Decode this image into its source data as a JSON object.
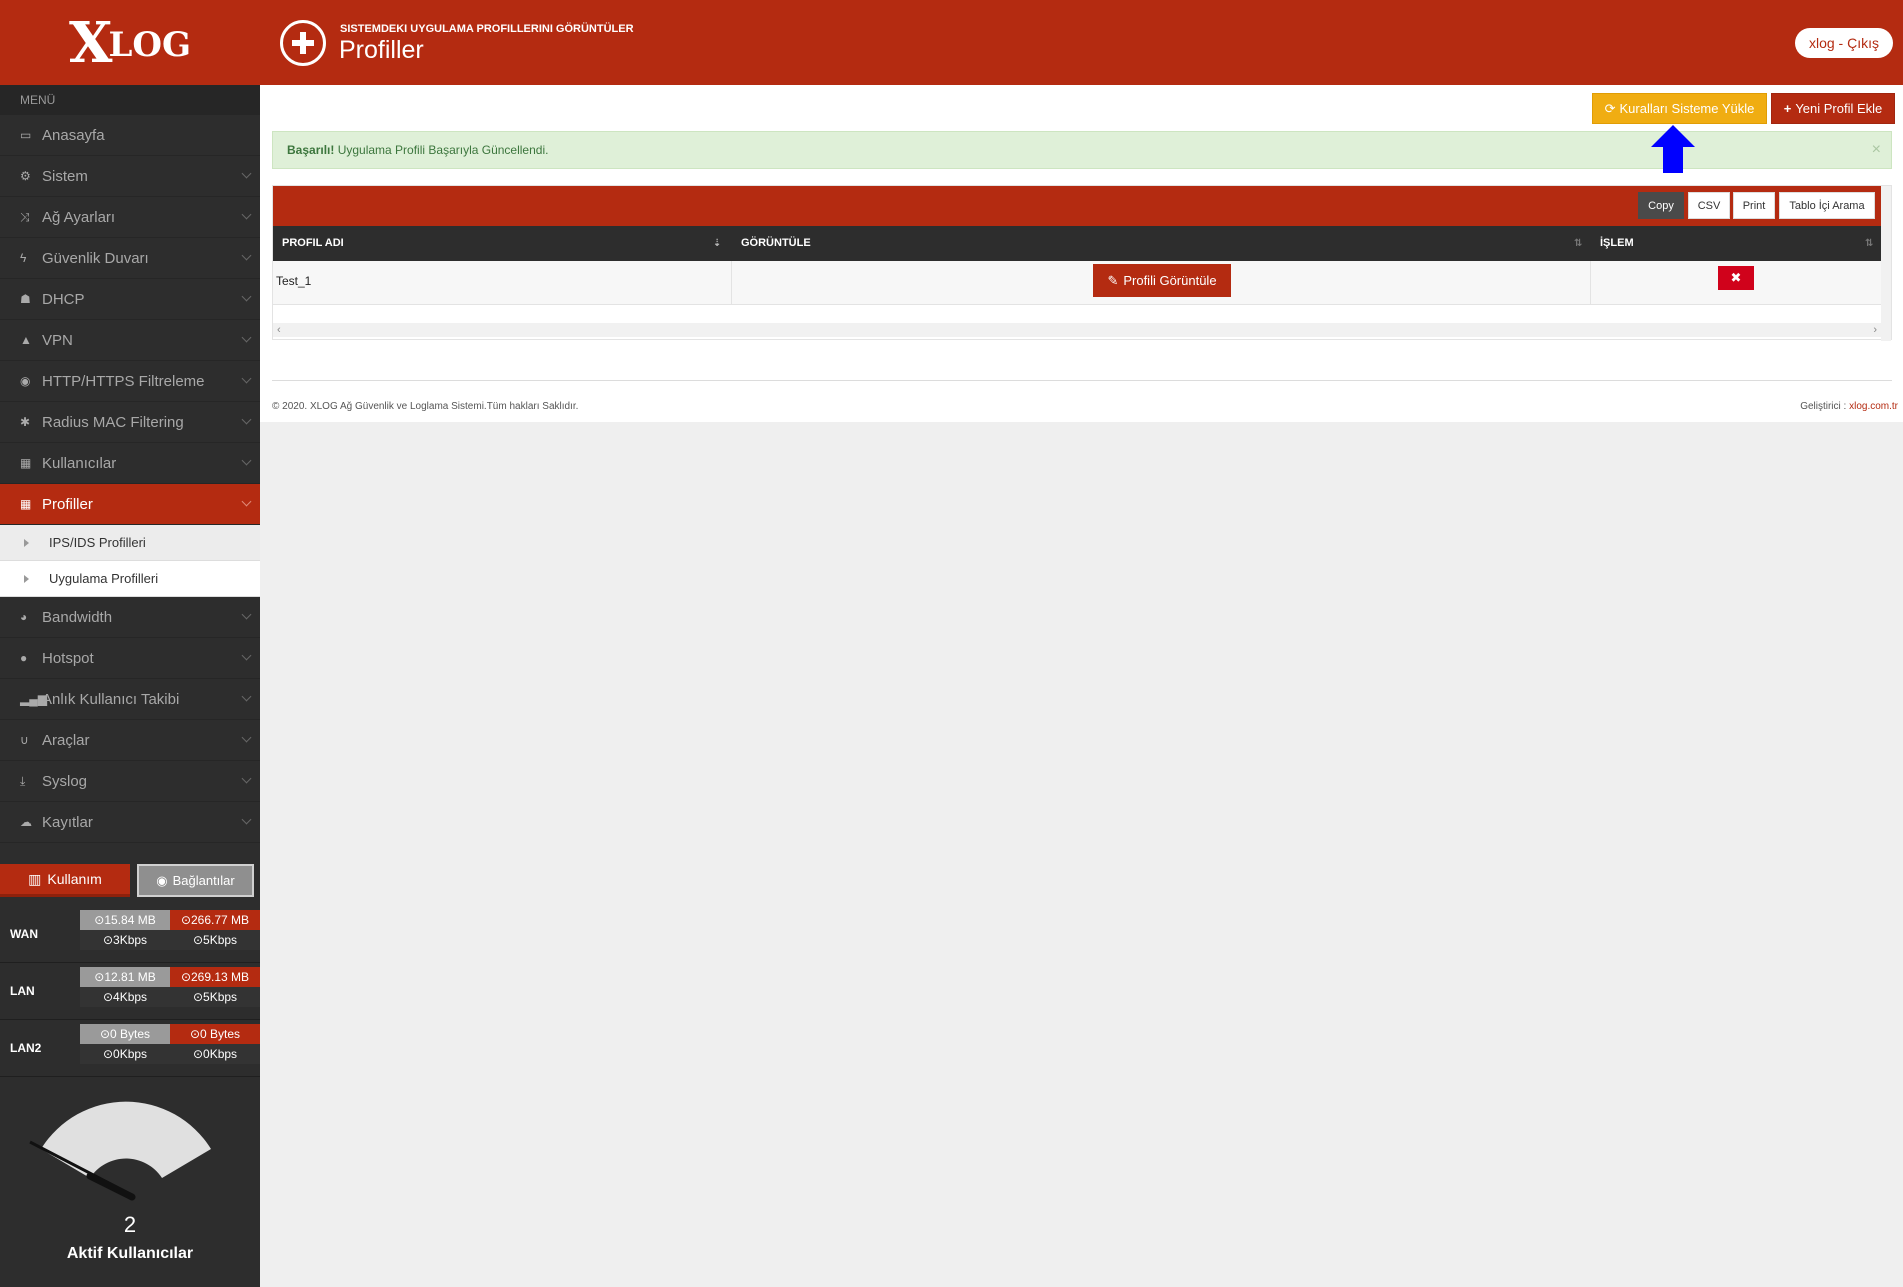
{
  "brand": {
    "logo_x": "X",
    "logo_rest": "LOG"
  },
  "header": {
    "subtitle": "SISTEMDEKI UYGULAMA PROFILLERINI GÖRÜNTÜLER",
    "title": "Profiller",
    "user_button": "xlog - Çıkış"
  },
  "sidebar": {
    "menu_label": "MENÜ",
    "items": [
      {
        "label": "Anasayfa",
        "icon": "laptop-icon"
      },
      {
        "label": "Sistem",
        "icon": "cogs-icon"
      },
      {
        "label": "Ağ Ayarları",
        "icon": "shuffle-icon"
      },
      {
        "label": "Güvenlik Duvarı",
        "icon": "bolt-icon"
      },
      {
        "label": "DHCP",
        "icon": "sitemap-icon"
      },
      {
        "label": "VPN",
        "icon": "road-icon"
      },
      {
        "label": "HTTP/HTTPS Filtreleme",
        "icon": "eye-slash-icon"
      },
      {
        "label": "Radius MAC Filtering",
        "icon": "asterisk-icon"
      },
      {
        "label": "Kullanıcılar",
        "icon": "grid-icon"
      },
      {
        "label": "Profiller",
        "icon": "grid-icon"
      },
      {
        "label": "Bandwidth",
        "icon": "dashboard-icon"
      },
      {
        "label": "Hotspot",
        "icon": "globe-icon"
      },
      {
        "label": "Anlık Kullanıcı Takibi",
        "icon": "signal-icon"
      },
      {
        "label": "Araçlar",
        "icon": "magnet-icon"
      },
      {
        "label": "Syslog",
        "icon": "download-icon"
      },
      {
        "label": "Kayıtlar",
        "icon": "cloud-icon"
      }
    ],
    "submenu": [
      {
        "label": "IPS/IDS Profilleri"
      },
      {
        "label": "Uygulama Profilleri"
      }
    ],
    "usage_button": "Kullanım",
    "connections_button": "Bağlantılar",
    "networks": [
      {
        "name": "WAN",
        "up": "15.84 MB",
        "down": "266.77 MB",
        "up_rate": "3Kbps",
        "down_rate": "5Kbps"
      },
      {
        "name": "LAN",
        "up": "12.81 MB",
        "down": "269.13 MB",
        "up_rate": "4Kbps",
        "down_rate": "5Kbps"
      },
      {
        "name": "LAN2",
        "up": "0 Bytes",
        "down": "0 Bytes",
        "up_rate": "0Kbps",
        "down_rate": "0Kbps"
      }
    ],
    "gauge": {
      "value": "2",
      "label": "Aktif Kullanıcılar"
    }
  },
  "toolbar": {
    "load_rules_button": "Kuralları Sisteme Yükle",
    "new_profile_button": "Yeni Profil Ekle"
  },
  "alert": {
    "strong": "Başarılı!",
    "message": " Uygulama Profili Başarıyla Güncellendi.",
    "close": "×"
  },
  "table": {
    "buttons": {
      "copy": "Copy",
      "csv": "CSV",
      "print": "Print",
      "search": "Tablo İçi Arama"
    },
    "columns": [
      "PROFIL ADI",
      "GÖRÜNTÜLE",
      "İŞLEM"
    ],
    "rows": [
      {
        "name": "Test_1",
        "view_button": "Profili Görüntüle",
        "delete_button": "✖"
      }
    ]
  },
  "footer": {
    "copyright": "© 2020. XLOG Ağ Güvenlik ve Loglama Sistemi.Tüm hakları Saklıdır.",
    "developer_label": "Geliştirici : ",
    "developer_link": "xlog.com.tr"
  },
  "colors": {
    "brand_red": "#b42b11",
    "sidebar_dark": "#2d2d2d",
    "warning_yellow": "#f0ad12",
    "success_bg": "#dff0d8",
    "arrow_blue": "#0000ff"
  }
}
